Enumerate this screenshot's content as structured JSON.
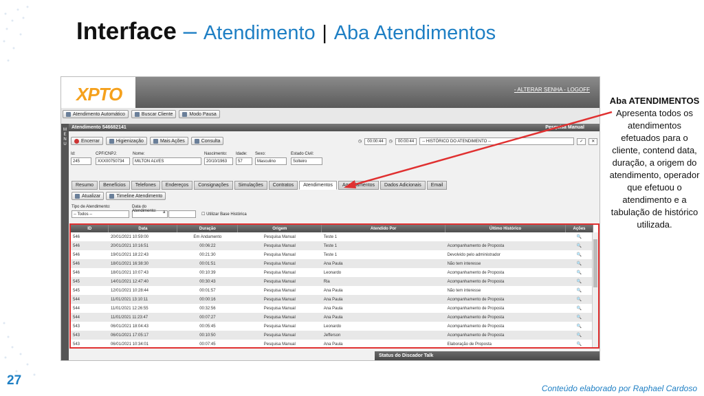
{
  "slide": {
    "title_main": "Interface",
    "title_dash": "–",
    "title_sub1": "Atendimento",
    "title_sep": "|",
    "title_sub2": "Aba Atendimentos",
    "page_number": "27",
    "credit": "Conteúdo elaborado por Raphael Cardoso"
  },
  "callout": {
    "title": "Aba ATENDIMENTOS",
    "text": "Apresenta todos os atendimentos efetuados para o cliente, contend data, duração, a origem do atendimento, operador que efetuou o atendimento e a tabulação de histórico utilizada."
  },
  "app": {
    "logo": "XPTO",
    "links": "- ALTERAR SENHA - LOGOFF",
    "toolbar": [
      {
        "label": "Atendimento Automático",
        "icon": "phone-icon"
      },
      {
        "label": "Buscar Cliente",
        "icon": "search-icon"
      },
      {
        "label": "Modo Pausa",
        "icon": "pause-icon"
      }
    ],
    "panel_title": "Atendimento 546682141",
    "panel_user": "Pesquisa Manual",
    "vertical_label": "MENU",
    "actions": [
      {
        "label": "Encerrar",
        "icon": "stop-icon"
      },
      {
        "label": "Higienização",
        "icon": "broom-icon"
      },
      {
        "label": "Mais Ações",
        "icon": "plus-icon"
      },
      {
        "label": "Consulta",
        "icon": "document-icon"
      }
    ],
    "timer1": "00:00:44",
    "timer2": "00:00:44",
    "history_placeholder": "-- HISTÓRICO DO ATENDIMENTO --",
    "fields": [
      {
        "label": "Id:",
        "value": "245"
      },
      {
        "label": "CPF/CNPJ:",
        "value": "XXX00750734"
      },
      {
        "label": "Nome:",
        "value": "MILTON ALVES"
      },
      {
        "label": "Nascimento:",
        "value": "20/10/1963"
      },
      {
        "label": "Idade:",
        "value": "57"
      },
      {
        "label": "Sexo:",
        "value": "Masculino"
      },
      {
        "label": "Estado Civil:",
        "value": "Solteiro"
      }
    ],
    "tabs": [
      "Resumo",
      "Benefícios",
      "Telefones",
      "Endereços",
      "Consignações",
      "Simulações",
      "Contratos",
      "Atendimentos",
      "Agendamentos",
      "Dados Adicionais",
      "Email"
    ],
    "active_tab": "Atendimentos",
    "sub_actions": [
      "Atualizar",
      "Timeline Atendimento"
    ],
    "filters": {
      "type_label": "Tipo de Atendimento:",
      "type_value": "-- Todos --",
      "date_label": "Data do Atendimento:",
      "date_sep": "a",
      "checkbox_label": "Utilizar Base Histórica"
    },
    "grid": {
      "columns": [
        "ID",
        "Data",
        "Duração",
        "Origem",
        "Atendido Por",
        "Último Histórico",
        "Ações"
      ],
      "rows": [
        [
          "546",
          "20/01/2021 10:59:00",
          "Em Andamento",
          "Pesquisa Manual",
          "Teste 1",
          ""
        ],
        [
          "546",
          "20/01/2021 10:16:51",
          "00:06:22",
          "Pesquisa Manual",
          "Teste 1",
          "Acompanhamento de Proposta"
        ],
        [
          "546",
          "19/01/2021 18:22:43",
          "00:21:30",
          "Pesquisa Manual",
          "Teste 1",
          "Devolvido pelo administrador"
        ],
        [
          "546",
          "18/01/2021 16:38:30",
          "00:01:51",
          "Pesquisa Manual",
          "Ana Paula",
          "Não tem interesse"
        ],
        [
          "546",
          "18/01/2021 10:07:43",
          "00:10:39",
          "Pesquisa Manual",
          "Leonardo",
          "Acompanhamento de Proposta"
        ],
        [
          "545",
          "14/01/2021 12:47:40",
          "00:30:43",
          "Pesquisa Manual",
          "Ria",
          "Acompanhamento de Proposta"
        ],
        [
          "545",
          "12/01/2021 10:28:44",
          "00:01:57",
          "Pesquisa Manual",
          "Ana Paula",
          "Não tem interesse"
        ],
        [
          "544",
          "11/01/2021 13:10:11",
          "00:00:16",
          "Pesquisa Manual",
          "Ana Paula",
          "Acompanhamento de Proposta"
        ],
        [
          "544",
          "11/01/2021 12:26:55",
          "00:32:56",
          "Pesquisa Manual",
          "Ana Paula",
          "Acompanhamento de Proposta"
        ],
        [
          "544",
          "11/01/2021 11:23:47",
          "00:07:27",
          "Pesquisa Manual",
          "Ana Paula",
          "Acompanhamento de Proposta"
        ],
        [
          "543",
          "06/01/2021 18:04:43",
          "00:05:45",
          "Pesquisa Manual",
          "Leonardo",
          "Acompanhamento de Proposta"
        ],
        [
          "543",
          "06/01/2021 17:05:17",
          "00:10:50",
          "Pesquisa Manual",
          "Jefferson",
          "Acompanhamento de Proposta"
        ],
        [
          "543",
          "06/01/2021 10:34:01",
          "00:07:45",
          "Pesquisa Manual",
          "Ana Paula",
          "Elaboração de Proposta"
        ]
      ]
    },
    "footer": "Status do Discador Talk"
  },
  "colors": {
    "accent_blue": "#1e7fc4",
    "highlight_red": "#e03030",
    "logo_orange": "#f5a11d"
  }
}
